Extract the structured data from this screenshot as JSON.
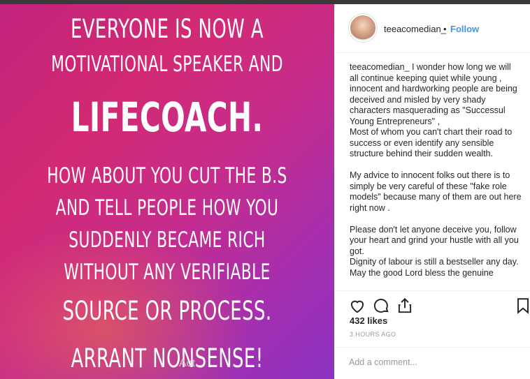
{
  "story_image": {
    "lines": [
      "EVERYONE IS NOW A",
      "MOTIVATIONAL SPEAKER AND",
      "LIFECOACH.",
      "HOW ABOUT YOU CUT THE B.S",
      "AND TELL PEOPLE HOW YOU",
      "SUDDENLY BECAME RICH",
      "WITHOUT ANY VERIFIABLE",
      "SOURCE OR PROCESS.",
      "ARRANT NONSENSE!"
    ]
  },
  "header": {
    "username": "teeacomedian_",
    "separator": "•",
    "follow_label": "Follow"
  },
  "caption": {
    "username": "teeacomedian_",
    "text": " I wonder how long we will all continue keeping quiet while young , innocent and hardworking people are being deceived and misled by very shady characters masquerading as \"Successul Young Entrepreneurs\" ,\nMost of whom you can't chart their road to success or even identify any sensible structure behind their sudden wealth.\n\nMy advice to innocent folks out there is to simply be very careful of these \"fake role models\" because many of them are out here right now .\n\nPlease don't let anyone deceive you, follow your heart and grind your hustle with all you got.\nDignity of labour is still a bestseller any day.\nMay the good Lord bless the genuine"
  },
  "actions": {
    "icons": [
      "heart-icon",
      "comment-icon",
      "share-icon",
      "bookmark-icon"
    ]
  },
  "likes": "432 likes",
  "time_ago": "3 HOURS AGO",
  "comment": {
    "placeholder": "Add a comment...",
    "value": ""
  },
  "watermark": "Act",
  "colors": {
    "follow": "#3897f0",
    "gradient_start": "#c2237d",
    "gradient_end": "#8b32c2"
  }
}
